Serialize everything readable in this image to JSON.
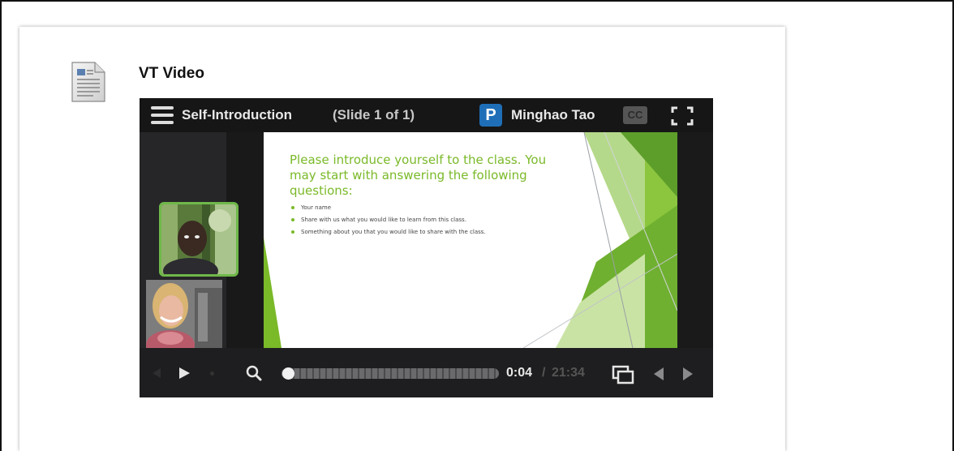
{
  "item": {
    "title": "VT Video",
    "icon": "document-icon"
  },
  "player": {
    "menu_icon": "hamburger-menu-icon",
    "presentation_title": "Self-Introduction",
    "slide_counter": "(Slide 1 of 1)",
    "presenter_logo": "P",
    "presenter_name": "Minghao Tao",
    "cc_label": "CC",
    "fullscreen_icon": "fullscreen-icon",
    "slide": {
      "heading": "Please introduce yourself to the class. You may start with answering the following questions:",
      "bullets": [
        "Your name",
        "Share with us what you would like to learn from this class.",
        "Something about you that you would like to share with the class."
      ],
      "accent_color": "#7ab928"
    },
    "controls": {
      "play_icon": "play-icon",
      "zoom_icon": "zoom-icon",
      "progress_fraction": 0.003,
      "current_time": "0:04",
      "separator": "/",
      "total_time": "21:34",
      "pip_icon": "picture-in-picture-icon",
      "prev_icon": "previous-slide-icon",
      "next_icon": "next-slide-icon"
    }
  }
}
